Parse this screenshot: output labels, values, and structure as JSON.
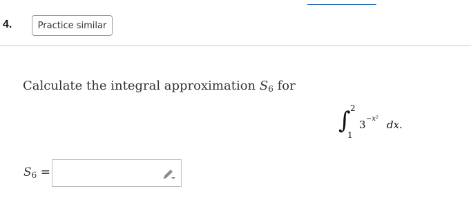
{
  "question": {
    "number": "4.",
    "practice_label": "Practice similar"
  },
  "problem": {
    "prompt_text": "Calculate the integral approximation",
    "approx_symbol": "S",
    "approx_subscript": "6",
    "prompt_suffix": "for"
  },
  "integral": {
    "sign": "∫",
    "upper_limit": "2",
    "lower_limit": "1",
    "base": "3",
    "exponent": "−x²",
    "differential": "dx."
  },
  "answer": {
    "symbol": "S",
    "subscript": "6",
    "equals": "=",
    "value": "",
    "input_icon": "pencil-icon"
  },
  "colors": {
    "top_rule": "#2a6fb3",
    "divider": "#c8c8c8",
    "button_border": "#9a9a9a"
  }
}
